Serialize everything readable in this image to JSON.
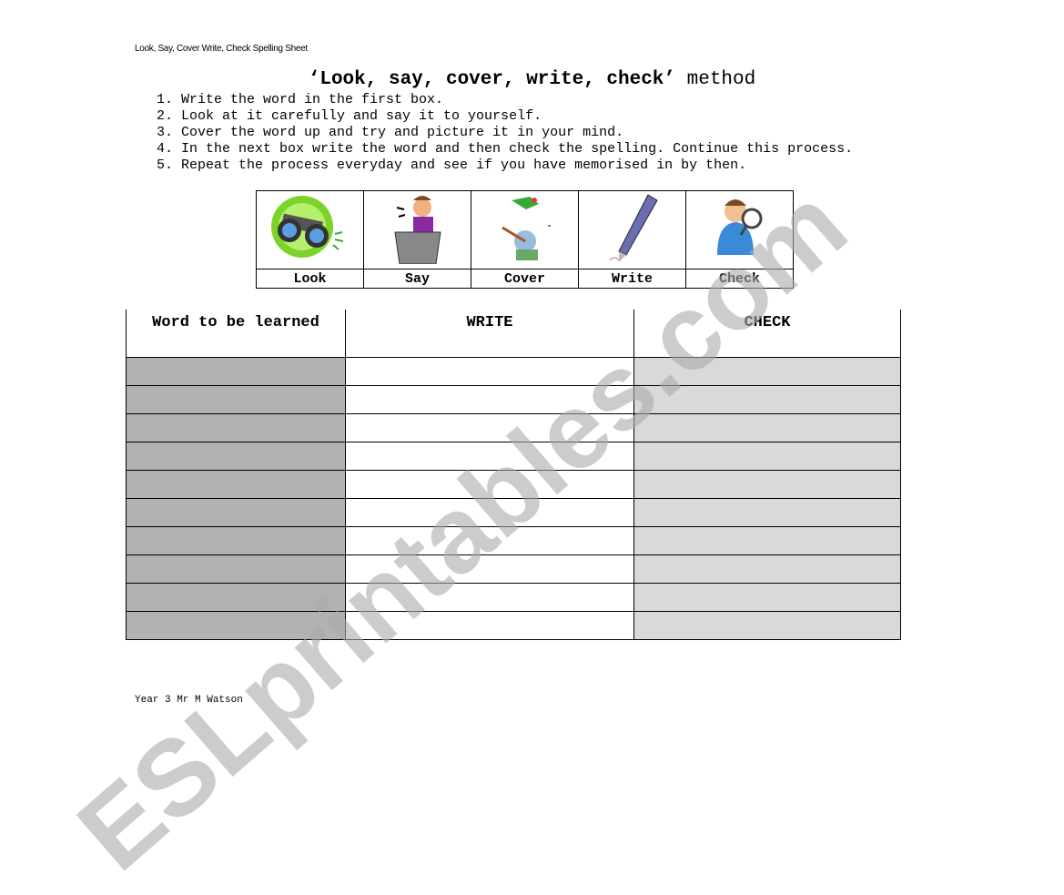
{
  "header_note": "Look, Say, Cover Write, Check Spelling Sheet",
  "title": {
    "bold": "‘Look, say, cover, write, check’",
    "normal": " method"
  },
  "steps": [
    "1. Write the word in the first box.",
    "2. Look at it carefully and say it to yourself.",
    "3. Cover the word up and try and picture it in your mind.",
    "4.  In the next box write the word and then check the spelling. Continue this process.",
    "5. Repeat the process everyday and see if you have memorised in by then."
  ],
  "pictures": [
    {
      "label": "Look",
      "icon": "binoculars-icon"
    },
    {
      "label": "Say",
      "icon": "speaking-person-icon"
    },
    {
      "label": "Cover",
      "icon": "hiding-person-icon"
    },
    {
      "label": "Write",
      "icon": "pen-icon"
    },
    {
      "label": "Check",
      "icon": "magnifying-glass-icon"
    }
  ],
  "table": {
    "headers": [
      "Word to be learned",
      "WRITE",
      "CHECK"
    ],
    "row_count": 10,
    "colors": {
      "word_column": "#b2b2b2",
      "check_column": "#d9d9d9"
    }
  },
  "footer": "Year 3 Mr M Watson",
  "watermark": "ESLprintables.com"
}
